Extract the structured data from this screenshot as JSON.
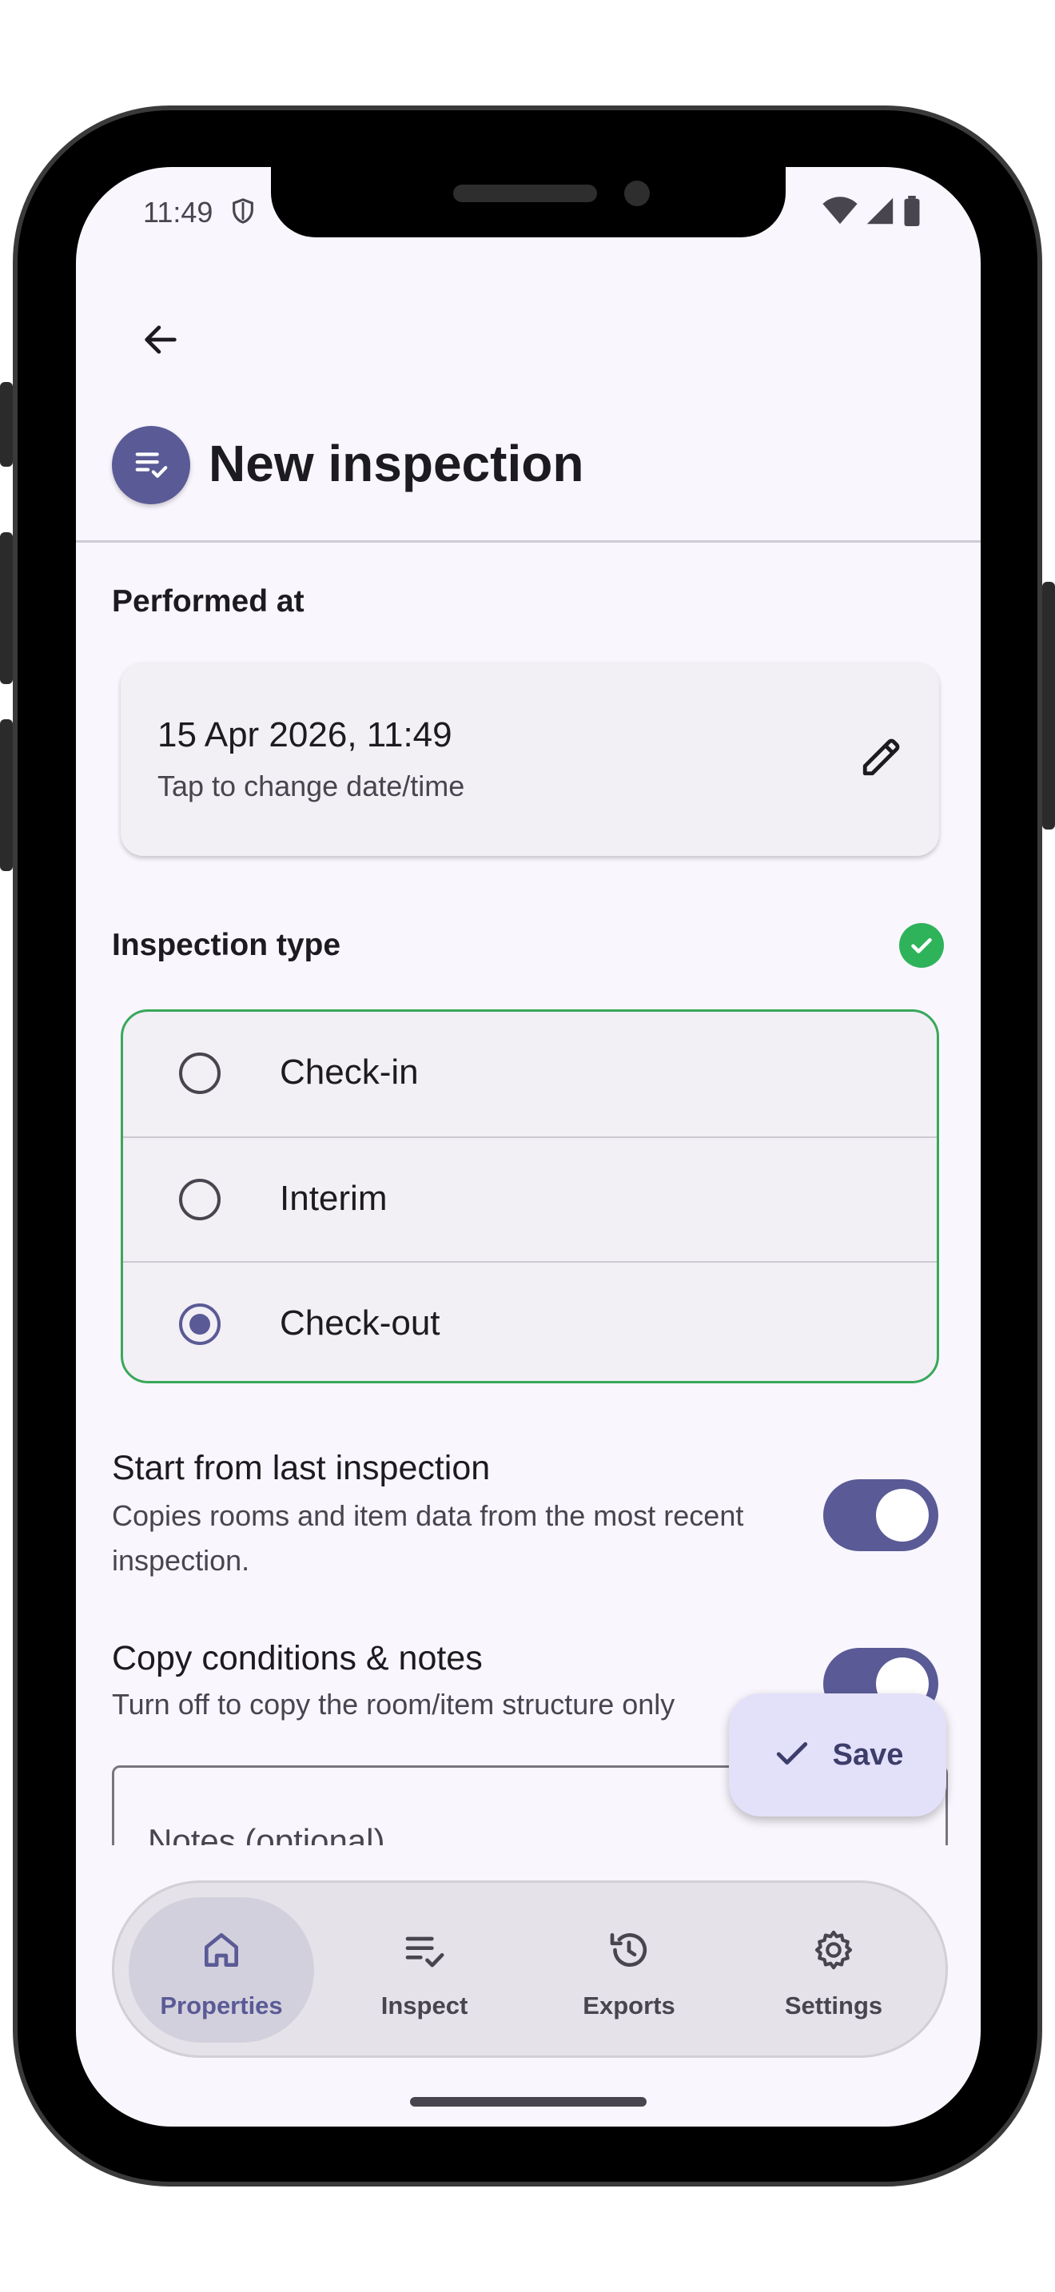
{
  "status_bar": {
    "time": "11:49"
  },
  "header": {
    "back_icon": "arrow-back-icon",
    "avatar_icon": "playlist-check-icon",
    "title": "New inspection"
  },
  "performed_at": {
    "label": "Performed at",
    "date_value": "15 Apr 2026, 11:49",
    "hint": "Tap to change date/time",
    "edit_icon": "pencil-icon"
  },
  "inspection_type": {
    "label": "Inspection type",
    "valid_color": "#2fb35a",
    "options": [
      {
        "label": "Check-in",
        "selected": false
      },
      {
        "label": "Interim",
        "selected": false
      },
      {
        "label": "Check-out",
        "selected": true
      }
    ]
  },
  "settings": [
    {
      "title": "Start from last inspection",
      "description": "Copies rooms and item data from the most recent inspection.",
      "enabled": true
    },
    {
      "title": "Copy conditions & notes",
      "description": "Turn off to copy the room/item structure only",
      "enabled": true
    }
  ],
  "notes": {
    "label": "Notes (optional)"
  },
  "fab": {
    "label": "Save",
    "icon": "check-icon"
  },
  "bottom_nav": [
    {
      "label": "Properties",
      "icon": "home-icon",
      "active": true
    },
    {
      "label": "Inspect",
      "icon": "checklist-icon",
      "active": false
    },
    {
      "label": "Exports",
      "icon": "history-icon",
      "active": false
    },
    {
      "label": "Settings",
      "icon": "gear-icon",
      "active": false
    }
  ],
  "colors": {
    "primary": "#5a5a96",
    "surface": "#f9f6fd",
    "card": "#f2eff5",
    "fab": "#e3e0fa",
    "success": "#2fb35a"
  }
}
